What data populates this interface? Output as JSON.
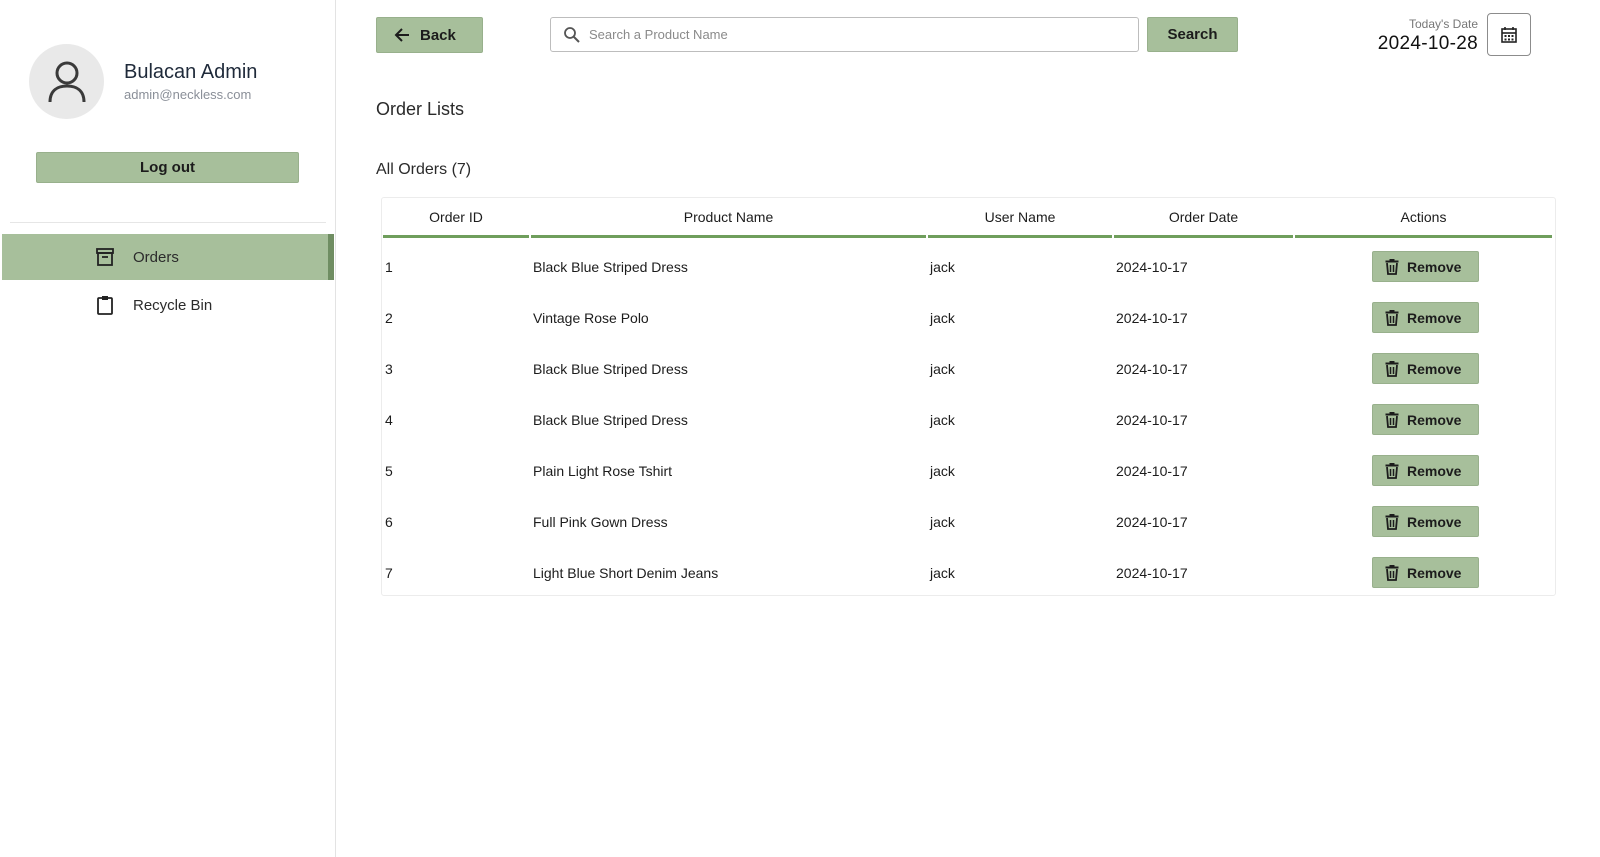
{
  "sidebar": {
    "profile": {
      "name": "Bulacan Admin",
      "email": "admin@neckless.com"
    },
    "logout_label": "Log out",
    "items": [
      {
        "label": "Orders",
        "icon": "archive-icon",
        "active": true
      },
      {
        "label": "Recycle Bin",
        "icon": "clipboard-icon",
        "active": false
      }
    ]
  },
  "header": {
    "back_label": "Back",
    "search_placeholder": "Search a Product Name",
    "search_label": "Search",
    "date_label": "Today's Date",
    "date_value": "2024-10-28"
  },
  "main": {
    "title": "Order Lists",
    "section_title": "All Orders (7)",
    "columns": [
      "Order ID",
      "Product Name",
      "User Name",
      "Order Date",
      "Actions"
    ],
    "remove_label": "Remove",
    "rows": [
      {
        "id": "1",
        "product": "Black Blue Striped Dress",
        "user": "jack",
        "date": "2024-10-17"
      },
      {
        "id": "2",
        "product": "Vintage Rose Polo",
        "user": "jack",
        "date": "2024-10-17"
      },
      {
        "id": "3",
        "product": "Black Blue Striped Dress",
        "user": "jack",
        "date": "2024-10-17"
      },
      {
        "id": "4",
        "product": "Black Blue Striped Dress",
        "user": "jack",
        "date": "2024-10-17"
      },
      {
        "id": "5",
        "product": "Plain Light Rose Tshirt",
        "user": "jack",
        "date": "2024-10-17"
      },
      {
        "id": "6",
        "product": "Full Pink Gown Dress",
        "user": "jack",
        "date": "2024-10-17"
      },
      {
        "id": "7",
        "product": "Light Blue Short Denim Jeans",
        "user": "jack",
        "date": "2024-10-17"
      }
    ]
  },
  "colors": {
    "accent": "#a7bf9b",
    "accent_dark": "#6f8d62",
    "header_rule": "#6f9e5c"
  }
}
